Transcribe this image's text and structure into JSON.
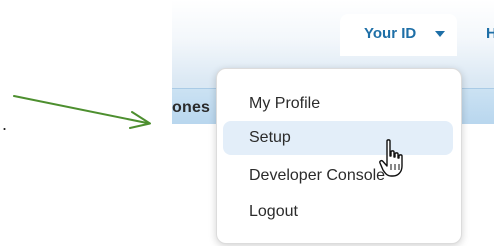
{
  "header": {
    "tab_partial_label": "ones",
    "user_menu_label": "Your ID",
    "next_tab_label": "H"
  },
  "annotation": {
    "dot": "."
  },
  "user_menu": {
    "items": [
      {
        "label": "My Profile"
      },
      {
        "label": "Setup",
        "hovered": true
      },
      {
        "label": "Developer Console"
      },
      {
        "label": "Logout"
      }
    ]
  },
  "colors": {
    "accent_blue": "#1e6fa7",
    "arrow_green": "#4d8f2f",
    "hover_bg": "#e3eef9"
  },
  "icons": {
    "cursor": "hand-pointer-icon",
    "arrow": "arrow-right-icon",
    "caret": "caret-down-icon"
  }
}
